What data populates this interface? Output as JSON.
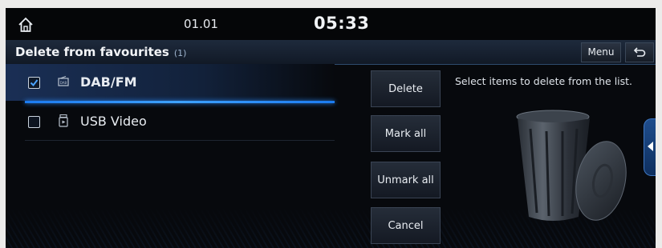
{
  "status": {
    "date": "01.01",
    "time": "05:33"
  },
  "header": {
    "title": "Delete from favourites",
    "count": "(1)",
    "menu_label": "Menu"
  },
  "list": {
    "items": [
      {
        "label": "DAB/FM",
        "checked": true,
        "icon": "radio-icon"
      },
      {
        "label": "USB Video",
        "checked": false,
        "icon": "usb-video-icon"
      }
    ]
  },
  "actions": {
    "delete": "Delete",
    "mark_all": "Mark all",
    "unmark_all": "Unmark all",
    "cancel": "Cancel"
  },
  "help": {
    "text": "Select items to delete from the list."
  },
  "colors": {
    "accent": "#2a8cff",
    "background": "#07090d"
  }
}
